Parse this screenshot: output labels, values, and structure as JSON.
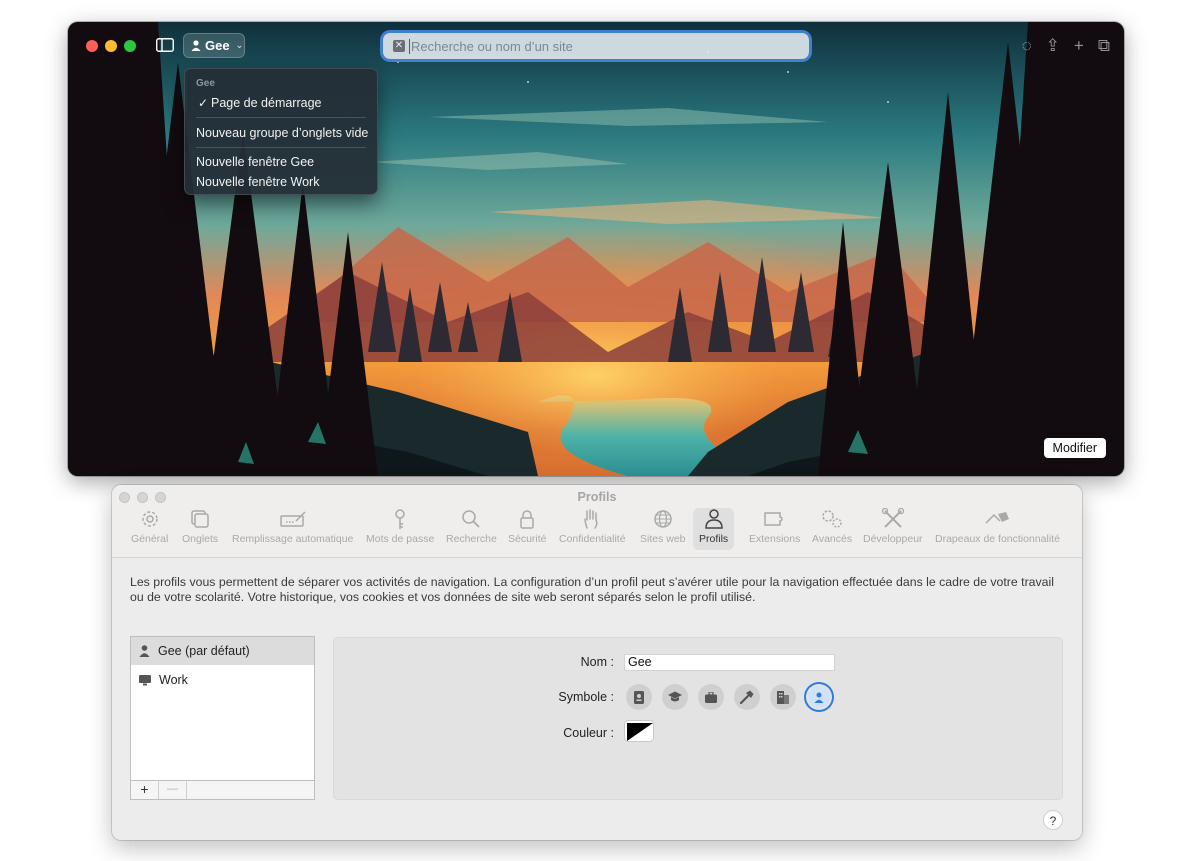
{
  "safari": {
    "profile_button": "Gee",
    "address_placeholder": "Recherche ou nom d’un site",
    "modifier_button": "Modifier",
    "profile_menu": {
      "header": "Gee",
      "check_mark": "✓",
      "items": [
        "Page de démarrage",
        "Nouveau groupe d’onglets vide",
        "Nouvelle fenêtre Gee",
        "Nouvelle fenêtre Work"
      ],
      "checked_item": "Page de démarrage"
    }
  },
  "prefs": {
    "title": "Profils",
    "tabs": [
      {
        "label": "Général",
        "icon": "gear-icon"
      },
      {
        "label": "Onglets",
        "icon": "tabs-icon"
      },
      {
        "label": "Remplissage automatique",
        "icon": "autofill-icon"
      },
      {
        "label": "Mots de passe",
        "icon": "key-icon"
      },
      {
        "label": "Recherche",
        "icon": "magnifier-icon"
      },
      {
        "label": "Sécurité",
        "icon": "lock-icon"
      },
      {
        "label": "Confidentialité",
        "icon": "hand-icon"
      },
      {
        "label": "Sites web",
        "icon": "globe-icon"
      },
      {
        "label": "Profils",
        "icon": "person-icon"
      },
      {
        "label": "Extensions",
        "icon": "puzzle-icon"
      },
      {
        "label": "Avancés",
        "icon": "gears-icon"
      },
      {
        "label": "Développeur",
        "icon": "tools-icon"
      },
      {
        "label": "Drapeaux de fonctionnalité",
        "icon": "flags-icon"
      }
    ],
    "active_tab": "Profils",
    "description": "Les profils vous permettent de séparer vos activités de navigation. La configuration d’un profil peut s’avérer utile pour la navigation effectuée dans le cadre de votre travail ou de votre scolarité. Votre historique, vos cookies et vos données de site web seront séparés selon le profil utilisé.",
    "profiles": [
      {
        "label": "Gee (par défaut)",
        "icon": "person-icon",
        "selected": true
      },
      {
        "label": "Work",
        "icon": "monitor-icon",
        "selected": false
      }
    ],
    "add_button": "+",
    "remove_button": "—",
    "name_label": "Nom :",
    "name_value": "Gee",
    "symbol_label": "Symbole :",
    "symbols": [
      "id-card-icon",
      "graduation-cap-icon",
      "briefcase-icon",
      "hammer-icon",
      "building-icon",
      "person-icon"
    ],
    "selected_symbol": "person-icon",
    "color_label": "Couleur :",
    "color_value": "#000000",
    "help_button": "?"
  },
  "colors": {
    "accent": "#2d7de0",
    "traffic_close": "#ff5f57",
    "traffic_minimize": "#febc2e",
    "traffic_maximize": "#28c840"
  }
}
